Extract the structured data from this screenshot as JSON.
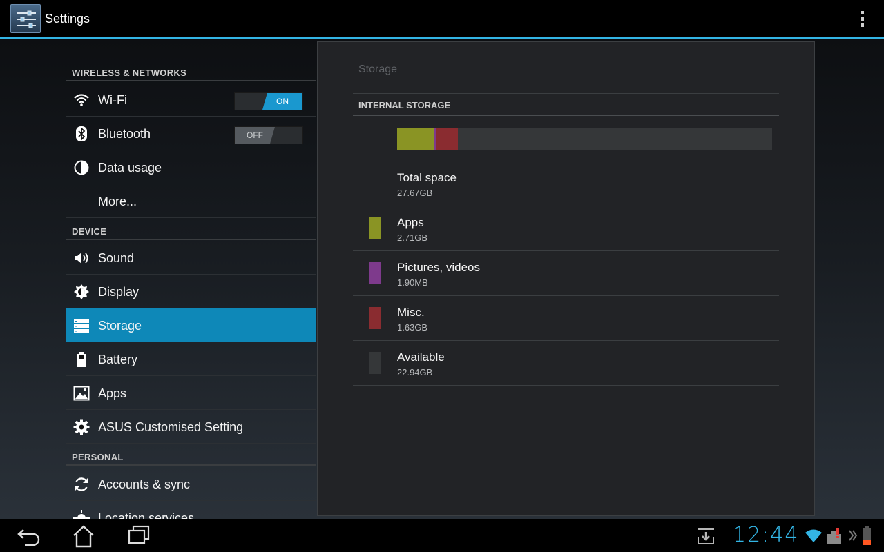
{
  "app": {
    "title": "Settings"
  },
  "sections": {
    "wireless": "WIRELESS & NETWORKS",
    "device": "DEVICE",
    "personal": "PERSONAL"
  },
  "items": {
    "wifi": {
      "label": "Wi-Fi",
      "toggle": "ON",
      "icon": "wifi-icon"
    },
    "bluetooth": {
      "label": "Bluetooth",
      "toggle": "OFF",
      "icon": "bluetooth-icon"
    },
    "data_usage": {
      "label": "Data usage",
      "icon": "data-usage-icon"
    },
    "more": {
      "label": "More..."
    },
    "sound": {
      "label": "Sound",
      "icon": "speaker-icon"
    },
    "display": {
      "label": "Display",
      "icon": "brightness-icon"
    },
    "storage": {
      "label": "Storage",
      "icon": "storage-icon",
      "selected": true
    },
    "battery": {
      "label": "Battery",
      "icon": "battery-icon"
    },
    "apps": {
      "label": "Apps",
      "icon": "apps-icon"
    },
    "asus": {
      "label": "ASUS Customised Setting",
      "icon": "gear-icon"
    },
    "accounts": {
      "label": "Accounts & sync",
      "icon": "sync-icon"
    },
    "location": {
      "label": "Location services",
      "icon": "location-icon"
    }
  },
  "storage": {
    "title": "Storage",
    "section": "INTERNAL STORAGE",
    "total": {
      "name": "Total space",
      "size": "27.67GB"
    },
    "rows": [
      {
        "name": "Apps",
        "size": "2.71GB",
        "color": "#8a9424"
      },
      {
        "name": "Pictures, videos",
        "size": "1.90MB",
        "color": "#7e3a8c"
      },
      {
        "name": "Misc.",
        "size": "1.63GB",
        "color": "#8a2c30"
      },
      {
        "name": "Available",
        "size": "22.94GB",
        "color": "#353739"
      }
    ],
    "bar_fractions": {
      "apps": 0.098,
      "pictures": 0.006,
      "misc": 0.059
    }
  },
  "statusbar": {
    "time": "12:44",
    "accent": "#33b5e5"
  }
}
